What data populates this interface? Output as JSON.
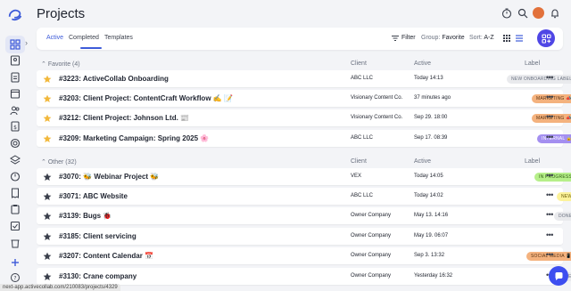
{
  "page_title": "Projects",
  "tabs": [
    {
      "label": "Active"
    },
    {
      "label": "Completed"
    },
    {
      "label": "Templates"
    }
  ],
  "toolbar": {
    "filter_label": "Filter",
    "group_label": "Group:",
    "group_value": "Favorite",
    "sort_label": "Sort:",
    "sort_value": "A-Z"
  },
  "columns": {
    "client": "Client",
    "active": "Active",
    "label": "Label"
  },
  "groups": [
    {
      "title": "Favorite (4)",
      "projects": [
        {
          "name": "#3223: ActiveCollab Onboarding",
          "client": "ABC LLC",
          "active": "Today 14:13",
          "label": "NEW ONBOARDING LABEL",
          "label_bg": "#e9eaed",
          "label_fg": "#6b7280",
          "starred": true
        },
        {
          "name": "#3203: Client Project: ContentCraft Workflow ✍️ 📝",
          "client": "Visionary Content Co.",
          "active": "37 minutes ago",
          "label": "MARKETING 📣",
          "label_bg": "#f4b27e",
          "label_fg": "#5a3414",
          "starred": true
        },
        {
          "name": "#3212: Client Project: Johnson Ltd. 📰",
          "client": "Visionary Content Co.",
          "active": "Sep 29. 18:00",
          "label": "MARKETING 📣",
          "label_bg": "#f4b27e",
          "label_fg": "#5a3414",
          "starred": true
        },
        {
          "name": "#3209: Marketing Campaign: Spring 2025 🌸",
          "client": "ABC LLC",
          "active": "Sep 17. 08:39",
          "label": "INTERNAL 🔒",
          "label_bg": "#a48ff0",
          "label_fg": "#ffffff",
          "starred": true
        }
      ]
    },
    {
      "title": "Other (32)",
      "projects": [
        {
          "name": "#3070: 🐝 Webinar Project 🐝",
          "client": "VEX",
          "active": "Today 14:05",
          "label": "IN PROGRESS",
          "label_bg": "#b6ef8a",
          "label_fg": "#2f5d12",
          "starred": false
        },
        {
          "name": "#3071: ABC Website",
          "client": "ABC LLC",
          "active": "Today 14:02",
          "label": "NEW",
          "label_bg": "#fcf29a",
          "label_fg": "#6b5d08",
          "starred": false
        },
        {
          "name": "#3139: Bugs 🐞",
          "client": "Owner Company",
          "active": "May 13. 14:16",
          "label": "DONE",
          "label_bg": "#e9eaed",
          "label_fg": "#6b7280",
          "starred": false
        },
        {
          "name": "#3185: Client servicing",
          "client": "Owner Company",
          "active": "May 19. 06:07",
          "label": "",
          "label_bg": "",
          "label_fg": "",
          "starred": false
        },
        {
          "name": "#3207: Content Calendar 📅",
          "client": "Owner Company",
          "active": "Sep 3. 13:32",
          "label": "SOCIAL MEDIA 📱",
          "label_bg": "#f4b27e",
          "label_fg": "#5a3414",
          "starred": false
        },
        {
          "name": "#3130: Crane company",
          "client": "Owner Company",
          "active": "Yesterday 16:32",
          "label": "CRANE",
          "label_bg": "#e9eaed",
          "label_fg": "#6b7280",
          "starred": false
        }
      ]
    }
  ],
  "status_url": "next-app.activecollab.com/210083/projects/4329",
  "colors": {
    "accent": "#3d5bd9",
    "star": "#f2b83a",
    "star_off": "#3a3f4b",
    "fab": "#4f46e5"
  },
  "icons": {
    "rail": [
      "grid-icon",
      "contacts-icon",
      "document-icon",
      "calendar-icon",
      "users-icon",
      "invoice-icon",
      "target-icon",
      "layers-icon",
      "timer-icon",
      "receipt-icon",
      "clipboard-icon",
      "checklist-icon",
      "trash-icon",
      "add-icon",
      "help-icon"
    ],
    "header": [
      "timer-icon",
      "search-icon",
      "avatar",
      "bell-icon"
    ]
  }
}
